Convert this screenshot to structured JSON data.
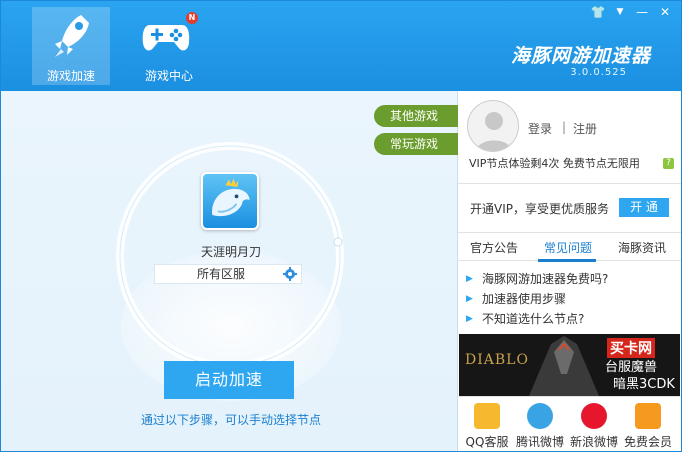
{
  "header": {
    "nav": [
      {
        "label": "游戏加速",
        "icon": "rocket-icon",
        "active": true
      },
      {
        "label": "游戏中心",
        "icon": "gamepad-icon",
        "badge": "N"
      }
    ],
    "brand": {
      "title": "海豚网游加速器",
      "version": "3.0.0.525"
    },
    "window_controls": {
      "skin": "👕",
      "menu": "▼",
      "minimize": "—",
      "close": "✕"
    }
  },
  "main": {
    "game": {
      "name": "天涯明月刀",
      "server": "所有区服"
    },
    "tags": {
      "other_games": "其他游戏",
      "frequent_games": "常玩游戏"
    },
    "start_button": "启动加速",
    "hint": "通过以下步骤，可以手动选择节点"
  },
  "side": {
    "login": "登录",
    "separator": "|",
    "register": "注册",
    "vip_trial": "VIP节点体验剩4次  免费节点无限用",
    "vip_help": "?",
    "vip_promo": "开通VIP，享受更优质服务",
    "vip_open": "开 通",
    "tabs": [
      {
        "label": "官方公告",
        "active": false
      },
      {
        "label": "常见问题",
        "active": true
      },
      {
        "label": "海豚资讯",
        "active": false
      }
    ],
    "faq": [
      "海豚网游加速器免费吗?",
      "加速器使用步骤",
      "不知道选什么节点?"
    ],
    "banner": {
      "title": "买卡网",
      "line2": "台服魔兽",
      "line3": "暗黑3CDK",
      "logo": "DIABLO"
    },
    "shortcuts": [
      {
        "label": "QQ客服",
        "icon": "qq-service-icon",
        "color": "#f5b82e"
      },
      {
        "label": "腾讯微博",
        "icon": "tencent-weibo-icon",
        "color": "#3aa3e3"
      },
      {
        "label": "新浪微博",
        "icon": "sina-weibo-icon",
        "color": "#e6162d"
      },
      {
        "label": "免费会员",
        "icon": "vip-icon",
        "color": "#f59a1f"
      }
    ]
  },
  "colors": {
    "accent": "#1b8fe0",
    "button": "#2ea7f0",
    "tag_green": "#6a9d2d",
    "link": "#1a7fd0"
  }
}
